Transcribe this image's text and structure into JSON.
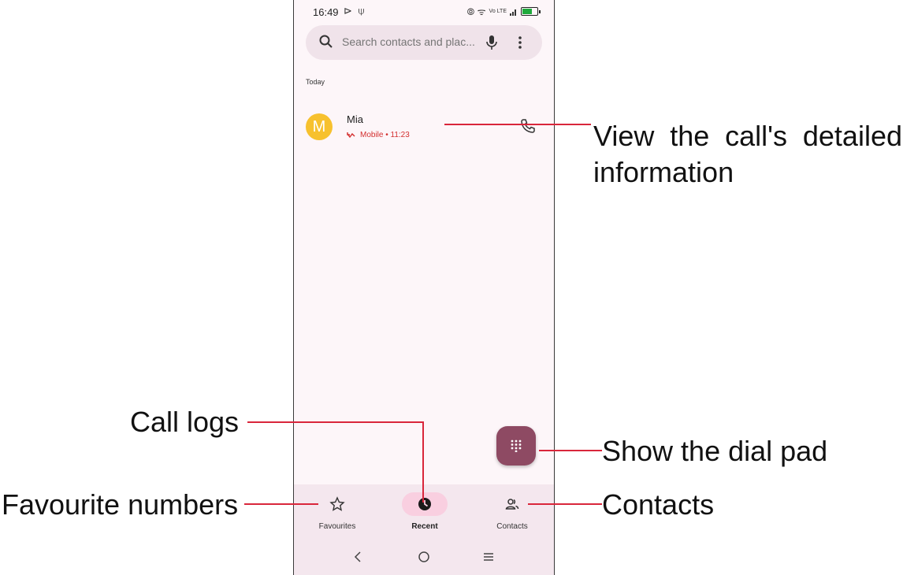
{
  "status": {
    "time": "16:49",
    "left_icons": "⊳ ⍦",
    "right_icons": "⦾ ᯤ",
    "lte": "Vo LTE",
    "battery_level": 0.7
  },
  "search": {
    "placeholder": "Search contacts and plac..."
  },
  "recents": {
    "section": "Today",
    "calls": [
      {
        "avatar_letter": "M",
        "name": "Mia",
        "detail": "Mobile • 11:23",
        "type": "missed-outgoing"
      }
    ]
  },
  "bottom_nav": [
    {
      "label": "Favourites",
      "icon": "star-icon",
      "active": false
    },
    {
      "label": "Recent",
      "icon": "clock-icon",
      "active": true
    },
    {
      "label": "Contacts",
      "icon": "people-icon",
      "active": false
    }
  ],
  "annotations": {
    "view_details_line1": "View the call's detailed",
    "view_details_line2": "information",
    "call_logs": "Call logs",
    "dial_pad": "Show the dial pad",
    "favourites": "Favourite numbers",
    "contacts": "Contacts"
  },
  "colors": {
    "accent": "#d9263b",
    "fab": "#8e4a63",
    "avatar": "#f7c12e",
    "missed": "#d32f2f",
    "active_pill": "#f9cfe0"
  }
}
